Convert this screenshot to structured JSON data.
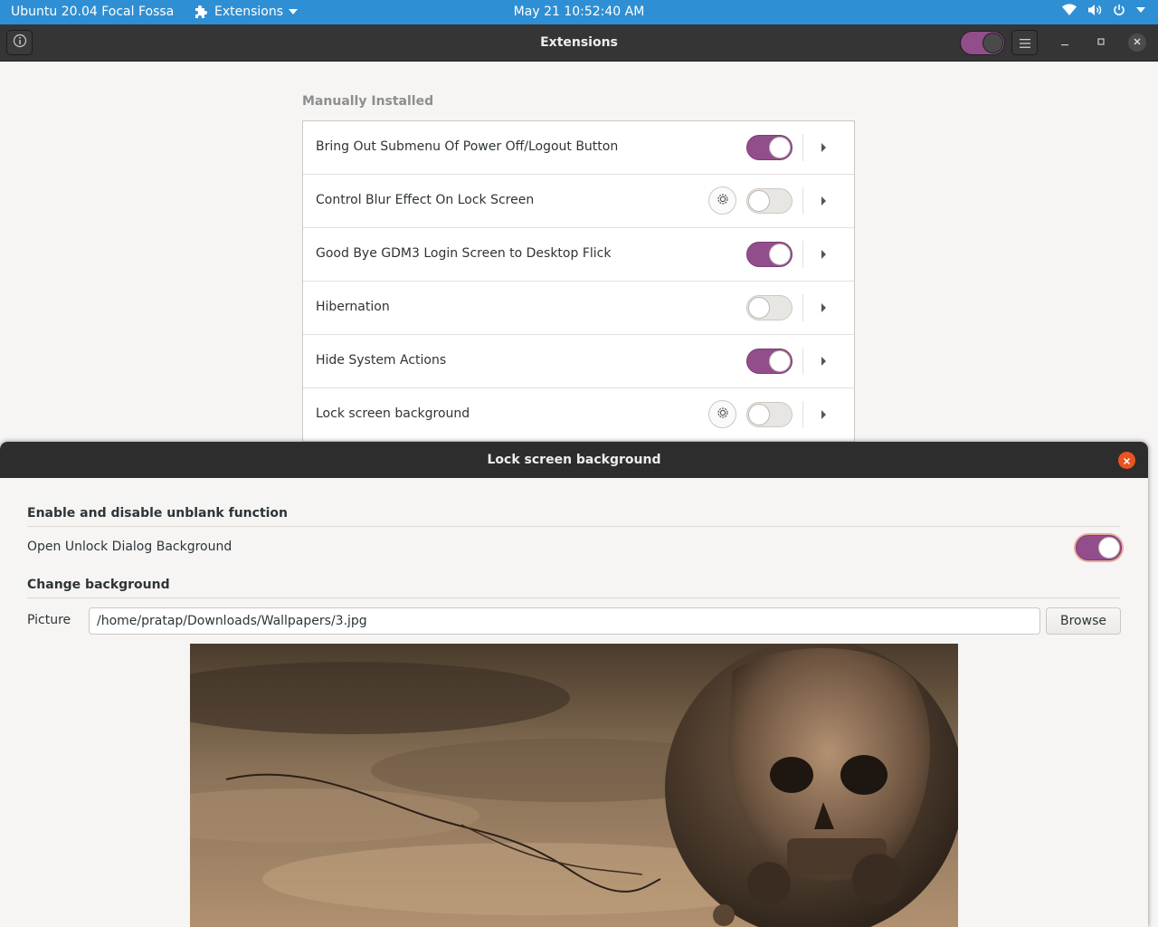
{
  "topbar": {
    "left_label": "Ubuntu 20.04 Focal Fossa",
    "app_menu": "Extensions",
    "clock": "May 21  10:52:40 AM",
    "icons": [
      "puzzle-icon",
      "wifi-icon",
      "volume-icon",
      "power-icon",
      "chevron-down-icon"
    ]
  },
  "window": {
    "title": "Extensions",
    "global_toggle_on": true
  },
  "extensions": {
    "section_title": "Manually Installed",
    "items": [
      {
        "name": "Bring Out Submenu Of Power Off/Logout Button",
        "enabled": true,
        "has_settings": false
      },
      {
        "name": "Control Blur Effect On Lock Screen",
        "enabled": false,
        "has_settings": true
      },
      {
        "name": "Good Bye GDM3 Login Screen to Desktop Flick",
        "enabled": true,
        "has_settings": false
      },
      {
        "name": "Hibernation",
        "enabled": false,
        "has_settings": false
      },
      {
        "name": "Hide System Actions",
        "enabled": true,
        "has_settings": false
      },
      {
        "name": "Lock screen background",
        "enabled": false,
        "has_settings": true
      }
    ]
  },
  "dialog": {
    "title": "Lock screen background",
    "section1": "Enable and disable unblank function",
    "unblank_label": "Open Unlock Dialog Background",
    "unblank_enabled": true,
    "section2": "Change background",
    "picture_label": "Picture",
    "picture_path": "/home/pratap/Downloads/Wallpapers/3.jpg",
    "browse_label": "Browse"
  },
  "colors": {
    "accent": "#924d8b",
    "topbar": "#2f8fd4",
    "close": "#e95420"
  }
}
